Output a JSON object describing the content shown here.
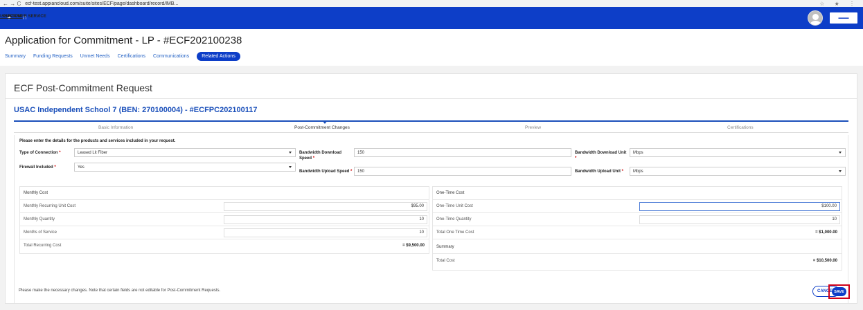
{
  "browser": {
    "url": "ecf-test.appiancloud.com/suite/sites/ECF/page/dashboard/record/lMB..."
  },
  "appnav": {
    "items": [
      {
        "label": "DASHBOARD",
        "icon": "dashboard-icon"
      },
      {
        "label": "CUSTOMER SERVICE",
        "icon": "headset-icon"
      }
    ]
  },
  "header": {
    "title": "Application for Commitment - LP - #ECF202100238",
    "tabs": [
      "Summary",
      "Funding Requests",
      "Unmet Needs",
      "Certifications",
      "Communications",
      "Related Actions"
    ],
    "active_tab": "Related Actions"
  },
  "card": {
    "title": "ECF Post-Commitment Request",
    "subtitle": "USAC Independent School 7 (BEN: 270100004) - #ECFPC202100117",
    "steps": [
      "Basic Information",
      "Post-Commitment Changes",
      "Preview",
      "Certifications"
    ],
    "current_step": "Post-Commitment Changes"
  },
  "form": {
    "instructions": "Please enter the details for the products and services included in your request.",
    "type_of_connection": {
      "label": "Type of Connection",
      "value": "Leased Lit Fiber"
    },
    "firewall_included": {
      "label": "Firewall Included",
      "value": "Yes"
    },
    "bw_download_speed": {
      "label": "Bandwidth Download Speed",
      "value": "150"
    },
    "bw_upload_speed": {
      "label": "Bandwidth Upload Speed",
      "value": "150"
    },
    "bw_download_unit": {
      "label": "Bandwidth Download Unit",
      "value": "Mbps"
    },
    "bw_upload_unit": {
      "label": "Bandwidth Upload Unit",
      "value": "Mbps"
    },
    "required_marker": "*"
  },
  "monthly": {
    "heading": "Monthly Cost",
    "rows": [
      {
        "label": "Monthly Recurring Unit Cost",
        "value": "$95.00"
      },
      {
        "label": "Monthly Quantity",
        "value": "10"
      },
      {
        "label": "Months of Service",
        "value": "10"
      }
    ],
    "total_label": "Total Recurring Cost",
    "total_value": "= $9,500.00"
  },
  "onetime": {
    "heading": "One-Time Cost",
    "rows": [
      {
        "label": "One-Time Unit Cost",
        "value": "$100.00"
      },
      {
        "label": "One-Time Quantity",
        "value": "10"
      }
    ],
    "total_label": "Total One Time Cost",
    "total_value": "= $1,000.00"
  },
  "summary": {
    "heading": "Summary",
    "total_label": "Total Cost",
    "total_value": "= $10,500.00"
  },
  "footer": {
    "note": "Please make the necessary changes. Note that certain fields are not editable for Post-Commitment Requests.",
    "cancel": "CANCEL",
    "save": "SAVE"
  }
}
